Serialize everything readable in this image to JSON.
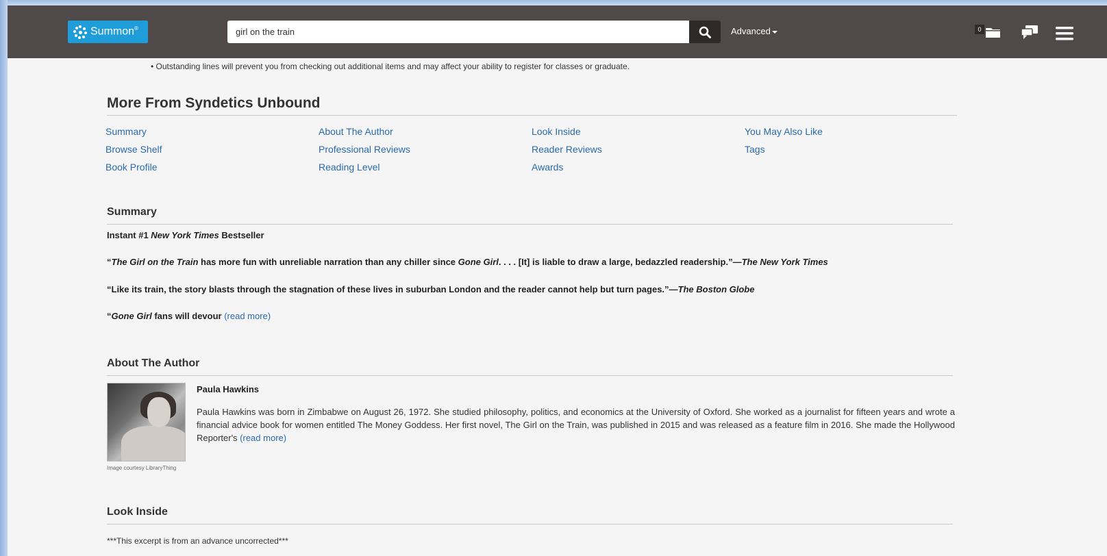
{
  "header": {
    "logo_text": "Summon",
    "logo_mark": "®",
    "search_value": "girl on the train",
    "advanced_label": "Advanced",
    "folder_count": "0"
  },
  "notice": "• Outstanding lines will prevent you from checking out additional items and may affect your ability to register for classes or graduate.",
  "more_from": {
    "title": "More From Syndetics Unbound",
    "columns": [
      [
        "Summary",
        "Browse Shelf",
        "Book Profile"
      ],
      [
        "About The Author",
        "Professional Reviews",
        "Reading Level"
      ],
      [
        "Look Inside",
        "Reader Reviews",
        "Awards"
      ],
      [
        "You May Also Like",
        "Tags"
      ]
    ]
  },
  "summary": {
    "title": "Summary",
    "line1_prefix": "Instant #1 ",
    "line1_italic": "New York Times",
    "line1_suffix": " Bestseller",
    "q1_open": "“",
    "q1_italic1": "The Girl on the Train",
    "q1_mid": " has more fun with unreliable narration than any chiller since ",
    "q1_italic2": "Gone Girl",
    "q1_end": ". . . . [It] is liable to draw a large, bedazzled readership.”—",
    "q1_source": "The New York Times",
    "q2_text": "“Like its train, the story blasts through the stagnation of these lives in suburban London and the reader cannot help but turn pages.”—",
    "q2_source": "The Boston Globe",
    "q3_open": "“",
    "q3_italic": "Gone Girl",
    "q3_text": " fans will devour ",
    "read_more": "(read more)"
  },
  "author": {
    "title": "About The Author",
    "name": "Paula Hawkins",
    "bio": "Paula Hawkins was born in Zimbabwe on August 26, 1972. She studied philosophy, politics, and economics at the University of Oxford. She worked as a journalist for fifteen years and wrote a financial advice book for women entitled The Money Goddess. Her first novel, The Girl on the Train, was published in 2015 and was released as a feature film in 2016. She made the Hollywood Reporter's ",
    "read_more": "(read more)",
    "photo_credit": "Image courtesy LibraryThing"
  },
  "look_inside": {
    "title": "Look Inside",
    "excerpt": "***This excerpt is from an advance uncorrected***"
  },
  "colors": {
    "header_bg": "#4f4949",
    "logo_bg": "#1e9dd8",
    "link": "#2a6aad"
  },
  "icons": [
    "search-icon",
    "folder-icon",
    "chat-icon",
    "menu-icon",
    "caret-down-icon"
  ]
}
